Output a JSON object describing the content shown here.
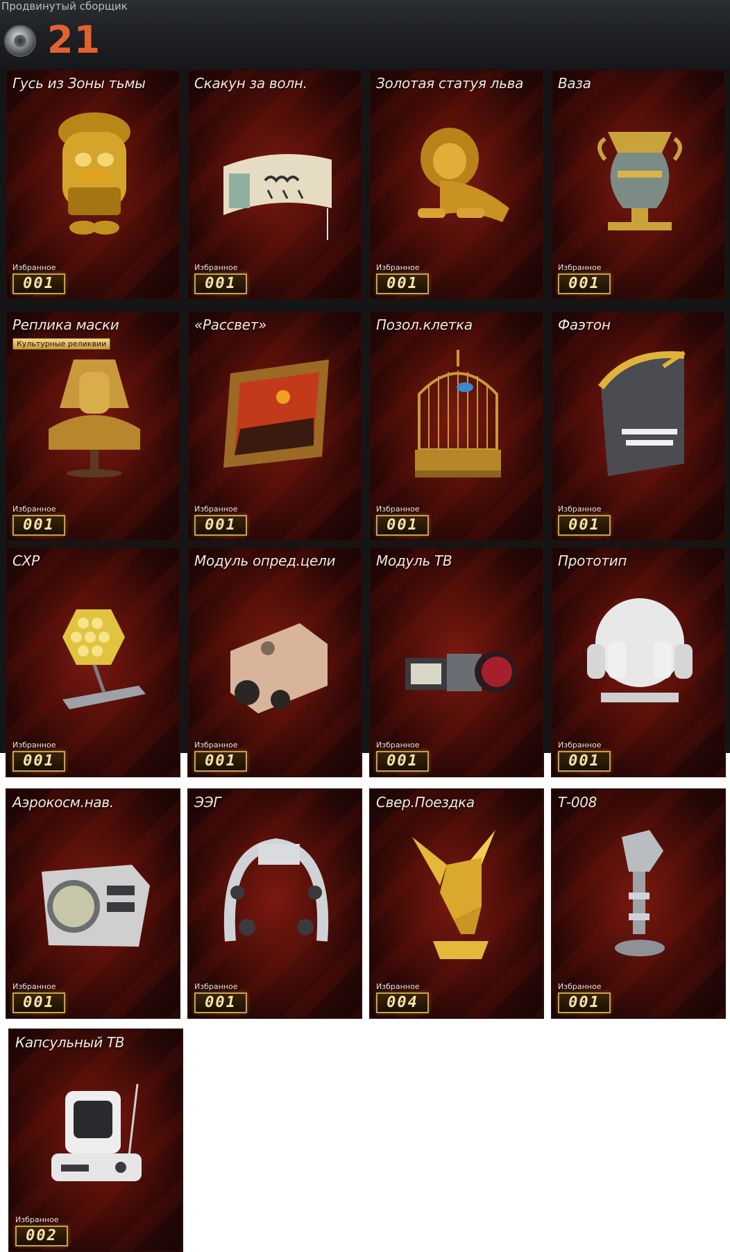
{
  "header": {
    "title": "Продвинутый сборщик",
    "count": "21",
    "emblem_icon": "prestige-emblem-icon"
  },
  "items": [
    {
      "name": "Гусь из Зоны тьмы",
      "fav": "Избранное",
      "qty": "001",
      "icon": "gold-goose-statue-icon",
      "art_color": "#d4a52a"
    },
    {
      "name": "Скакун за волн.",
      "fav": "Избранное",
      "qty": "001",
      "icon": "horse-scroll-painting-icon",
      "art_color": "#e0d6be"
    },
    {
      "name": "Золотая статуя льва",
      "fav": "Избранное",
      "qty": "001",
      "icon": "gold-lion-statue-icon",
      "art_color": "#c99223"
    },
    {
      "name": "Ваза",
      "fav": "Избранное",
      "qty": "001",
      "icon": "gold-vase-icon",
      "art_color": "#c6a040"
    },
    {
      "name": "Реплика маски",
      "tag": "Культурные реликвии",
      "fav": "Избранное",
      "qty": "001",
      "icon": "pharaoh-mask-icon",
      "art_color": "#c89a3c"
    },
    {
      "name": "«Рассвет»",
      "fav": "Избранное",
      "qty": "001",
      "icon": "framed-painting-icon",
      "art_color": "#b25a1e"
    },
    {
      "name": "Позол.клетка",
      "fav": "Избранное",
      "qty": "001",
      "icon": "gold-birdcage-icon",
      "art_color": "#c79b36"
    },
    {
      "name": "Фаэтон",
      "fav": "Избранное",
      "qty": "001",
      "icon": "doomsday-clock-plaque-icon",
      "art_color": "#4a4c52"
    },
    {
      "name": "СХР",
      "fav": "Избранное",
      "qty": "001",
      "icon": "hex-mirror-array-icon",
      "art_color": "#d8c040"
    },
    {
      "name": "Модуль опред.цели",
      "fav": "Избранное",
      "qty": "001",
      "icon": "target-module-camera-icon",
      "art_color": "#d8b59a"
    },
    {
      "name": "Модуль ТВ",
      "fav": "Избранное",
      "qty": "001",
      "icon": "tv-module-lens-icon",
      "art_color": "#8f2d2d"
    },
    {
      "name": "Прототип",
      "fav": "Избранное",
      "qty": "001",
      "icon": "prototype-sphere-icon",
      "art_color": "#e6e6e6"
    },
    {
      "name": "Аэрокосм.нав.",
      "fav": "Избранное",
      "qty": "001",
      "icon": "aerospace-nav-device-icon",
      "art_color": "#cfcfcf"
    },
    {
      "name": "ЭЭГ",
      "fav": "Избранное",
      "qty": "001",
      "icon": "eeg-headset-icon",
      "art_color": "#cfd2d6"
    },
    {
      "name": "Свер.Поездка",
      "fav": "Избранное",
      "qty": "004",
      "icon": "gold-pegasus-statue-icon",
      "art_color": "#e2b93a"
    },
    {
      "name": "Т-008",
      "fav": "Избранное",
      "qty": "001",
      "icon": "robot-arm-statue-icon",
      "art_color": "#b9bcc0"
    },
    {
      "name": "Капсульный ТВ",
      "fav": "Избранное",
      "qty": "002",
      "icon": "capsule-tv-icon",
      "art_color": "#eeeeee"
    }
  ]
}
